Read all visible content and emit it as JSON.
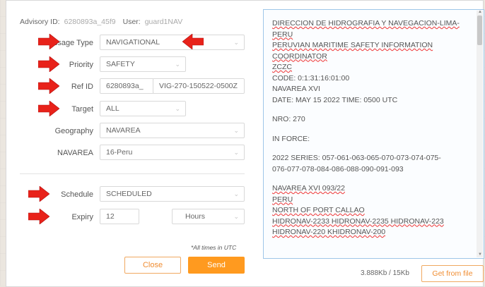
{
  "header": {
    "advisory_label": "Advisory ID:",
    "advisory_value": "6280893a_45f9",
    "user_label": "User:",
    "user_value": "guard1NAV"
  },
  "form": {
    "message_type": {
      "label": "Message Type",
      "value": "NAVIGATIONAL"
    },
    "priority": {
      "label": "Priority",
      "value": "SAFETY"
    },
    "ref_id": {
      "label": "Ref ID",
      "value_a": "6280893a_",
      "value_b": "VIG-270-150522-0500Z"
    },
    "target": {
      "label": "Target",
      "value": "ALL"
    },
    "geography": {
      "label": "Geography",
      "value": "NAVAREA"
    },
    "navarea": {
      "label": "NAVAREA",
      "value": "16-Peru"
    },
    "schedule": {
      "label": "Schedule",
      "value": "SCHEDULED"
    },
    "expiry": {
      "label": "Expiry",
      "value": "12",
      "unit": "Hours"
    }
  },
  "utc_note": "*All times in UTC",
  "buttons": {
    "close": "Close",
    "send": "Send",
    "get_from_file": "Get from file"
  },
  "message_lines": [
    "DIRECCION DE HIDROGRAFIA Y NAVEGACION-LIMA-",
    "PERU",
    "PERUVIAN MARITIME SAFETY INFORMATION",
    "COORDINATOR",
    "ZCZC",
    "CODE: 0:1:31:16:01:00",
    "NAVAREA XVI",
    "DATE: MAY 15 2022 TIME: 0500 UTC",
    "",
    "NRO: 270",
    "",
    "IN FORCE:",
    "",
    "2022 SERIES: 057-061-063-065-070-073-074-075-",
    "076-077-078-084-086-088-090-091-093",
    "",
    "NAVAREA XVI 093/22",
    "PERU",
    "NORTH OF PORT CALLAO",
    "HIDRONAV-2233 HIDRONAV-2235 HIDRONAV-223",
    "HIDRONAV-220 KHIDRONAV-200"
  ],
  "size_info": "3.888Kb / 15Kb",
  "colors": {
    "accent": "#ff9a1f",
    "arrow": "#e8221a",
    "message_border": "#9ec6e8"
  }
}
